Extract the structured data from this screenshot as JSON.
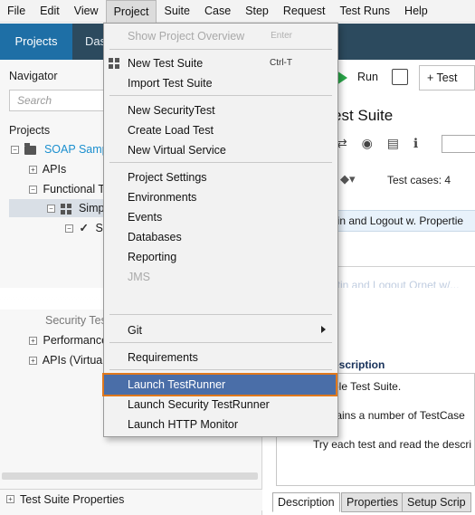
{
  "menubar": {
    "items": [
      "File",
      "Edit",
      "View",
      "Project",
      "Suite",
      "Case",
      "Step",
      "Request",
      "Test Runs",
      "Help"
    ],
    "active": "Project"
  },
  "topbar": {
    "projects_tab": "Projects",
    "dashboard_tab_partial": "Das"
  },
  "navigator": {
    "title": "Navigator",
    "search_placeholder": "Search",
    "projects_label": "Projects",
    "tree": [
      {
        "label": "SOAP Samp",
        "level": 0
      },
      {
        "label": "APIs",
        "level": 1
      },
      {
        "label": "Functional T",
        "level": 1
      },
      {
        "label": "Simp",
        "level": 2,
        "selected": true
      },
      {
        "label": "S",
        "level": 3
      },
      {
        "label": "Security Tes",
        "level": 1
      },
      {
        "label": "Performance",
        "level": 1
      },
      {
        "label": "APIs (Virtua",
        "level": 1
      }
    ],
    "properties_label": "Test Suite Properties"
  },
  "editor": {
    "run_label": "Run",
    "new_test_label": "Test",
    "title": "est Suite",
    "test_cases_label": "Test cases: 4",
    "test_case_row": "gin and Logout w. Propertie",
    "faded_row": "ntin and Logout Ornet w/...",
    "description_heading": "escription",
    "description_lines": [
      "ple Test Suite.",
      "tains a number of TestCase",
      "Try each test and read the descri"
    ],
    "bottom_tabs": [
      "Description",
      "Properties",
      "Setup Scrip"
    ]
  },
  "project_menu": {
    "items": [
      {
        "label": "Show Project Overview",
        "shortcut": "Enter",
        "disabled": true
      },
      {
        "label": "New Test Suite",
        "shortcut": "Ctrl-T",
        "icon": "grid-icon"
      },
      {
        "label": "Import Test Suite"
      },
      {
        "label": "New SecurityTest"
      },
      {
        "label": "Create Load Test"
      },
      {
        "label": "New Virtual Service"
      },
      {
        "label": "Project Settings"
      },
      {
        "label": "Environments"
      },
      {
        "label": "Events"
      },
      {
        "label": "Databases"
      },
      {
        "label": "Reporting"
      },
      {
        "label": "JMS",
        "disabled": true
      },
      {
        "label": "Git",
        "submenu": true
      },
      {
        "label": "Requirements"
      },
      {
        "label": "Launch TestRunner",
        "highlighted": true
      },
      {
        "label": "Launch Security TestRunner"
      },
      {
        "label": "Launch HTTP Monitor"
      }
    ]
  },
  "colors": {
    "topbar": "#2c4a5e",
    "projects_tab": "#1e6fa6",
    "highlight": "#4a6ea8",
    "highlight_border": "#e0781c",
    "project_link": "#1b8fcf",
    "run_green": "#2aa84a"
  }
}
